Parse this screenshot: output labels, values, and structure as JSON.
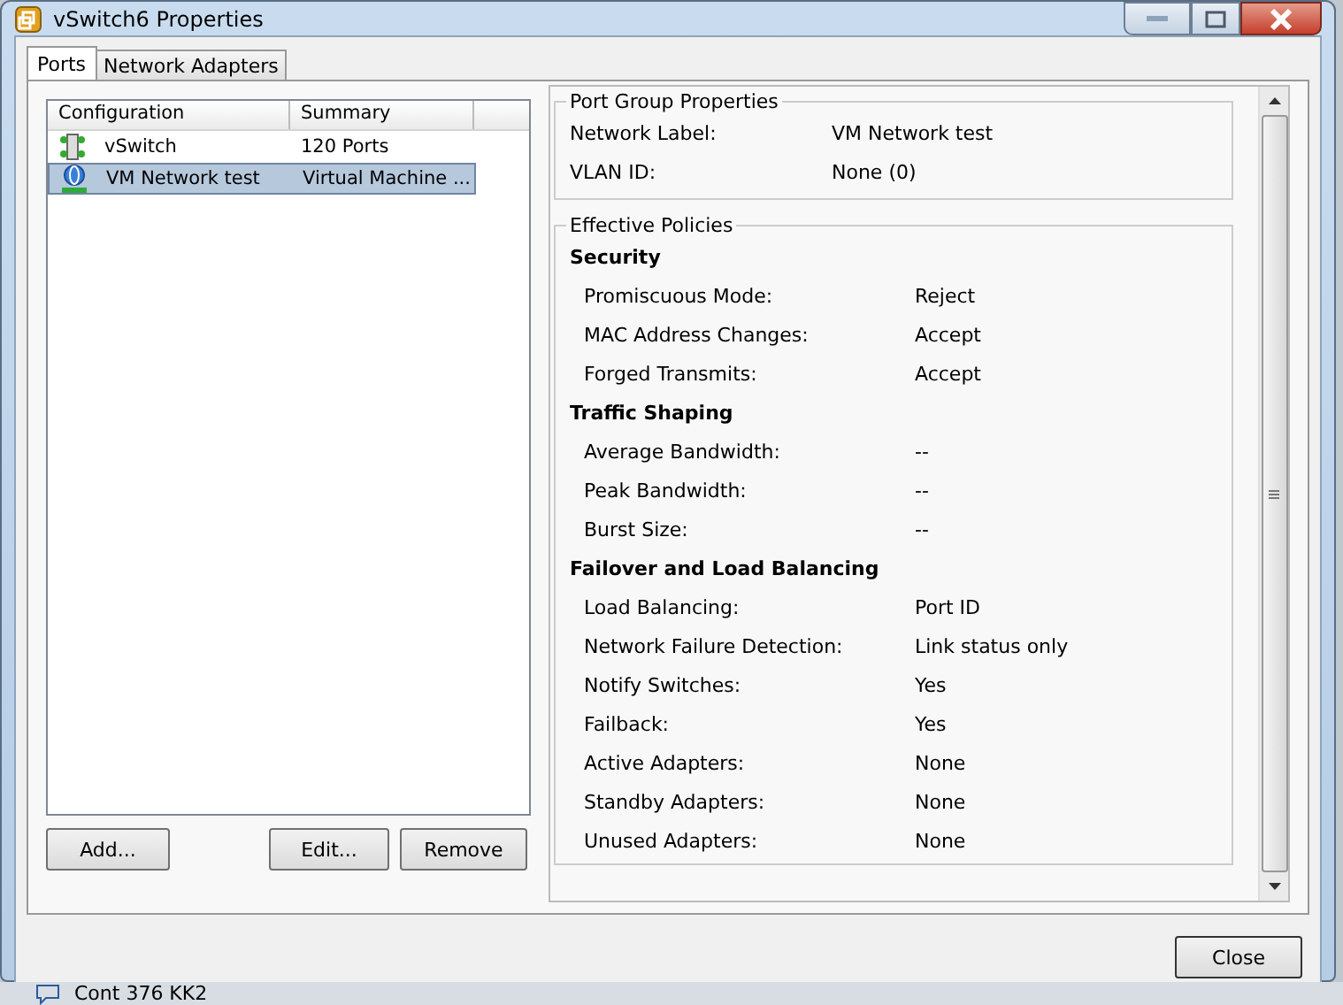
{
  "window": {
    "title": "vSwitch6 Properties"
  },
  "tabs": [
    {
      "label": "Ports",
      "selected": true
    },
    {
      "label": "Network Adapters",
      "selected": false
    }
  ],
  "list": {
    "columns": [
      "Configuration",
      "Summary"
    ],
    "rows": [
      {
        "kind": "switch",
        "name": "vSwitch",
        "summary": "120 Ports",
        "selected": false
      },
      {
        "kind": "portgroup",
        "name": "VM Network test",
        "summary": "Virtual Machine ...",
        "selected": true
      }
    ]
  },
  "list_buttons": [
    "Add...",
    "Edit...",
    "Remove"
  ],
  "port_group_properties": {
    "title": "Port Group Properties",
    "items": [
      {
        "label": "Network Label:",
        "value": "VM Network test"
      },
      {
        "label": "VLAN ID:",
        "value": "None (0)"
      }
    ]
  },
  "effective_policies": {
    "title": "Effective Policies",
    "sections": [
      {
        "heading": "Security",
        "items": [
          {
            "label": "Promiscuous Mode:",
            "value": "Reject"
          },
          {
            "label": "MAC Address Changes:",
            "value": "Accept"
          },
          {
            "label": "Forged Transmits:",
            "value": "Accept"
          }
        ]
      },
      {
        "heading": "Traffic Shaping",
        "items": [
          {
            "label": "Average Bandwidth:",
            "value": "--"
          },
          {
            "label": "Peak Bandwidth:",
            "value": "--"
          },
          {
            "label": "Burst Size:",
            "value": "--"
          }
        ]
      },
      {
        "heading": "Failover and Load Balancing",
        "items": [
          {
            "label": "Load Balancing:",
            "value": "Port ID"
          },
          {
            "label": "Network Failure Detection:",
            "value": "Link status only"
          },
          {
            "label": "Notify Switches:",
            "value": "Yes"
          },
          {
            "label": "Failback:",
            "value": "Yes"
          },
          {
            "label": "Active Adapters:",
            "value": "None"
          },
          {
            "label": "Standby Adapters:",
            "value": "None"
          },
          {
            "label": "Unused Adapters:",
            "value": "None"
          }
        ]
      }
    ]
  },
  "close_button": "Close",
  "taskbar": {
    "text": "Cont 376 KK2"
  }
}
